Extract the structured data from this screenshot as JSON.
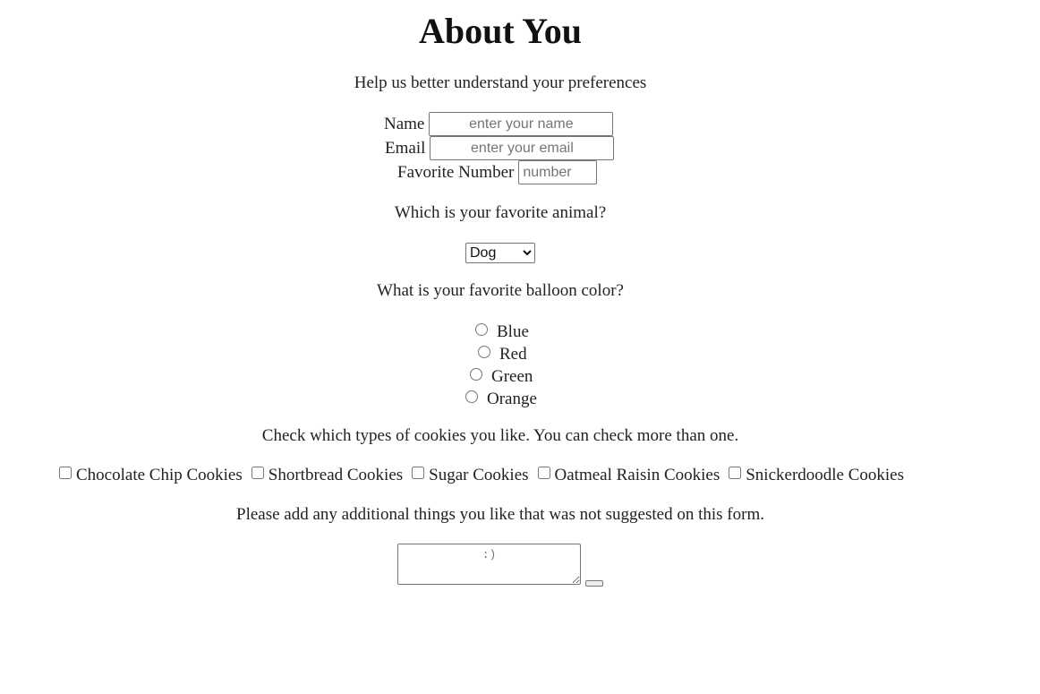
{
  "page": {
    "title": "About You",
    "subtitle": "Help us better understand your preferences"
  },
  "fields": {
    "name_label": "Name",
    "name_placeholder": "enter your name",
    "email_label": "Email",
    "email_placeholder": "enter your email",
    "number_label": "Favorite Number",
    "number_placeholder": "number"
  },
  "animal": {
    "question": "Which is your favorite animal?",
    "selected": "Dog"
  },
  "balloon": {
    "question": "What is your favorite balloon color?",
    "options": [
      "Blue",
      "Red",
      "Green",
      "Orange"
    ]
  },
  "cookies": {
    "question": "Check which types of cookies you like. You can check more than one.",
    "options": [
      "Chocolate Chip Cookies",
      "Shortbread Cookies",
      "Sugar Cookies",
      "Oatmeal Raisin Cookies",
      "Snickerdoodle Cookies"
    ]
  },
  "additional": {
    "question": "Please add any additional things you like that was not suggested on this form.",
    "placeholder": ":)"
  }
}
